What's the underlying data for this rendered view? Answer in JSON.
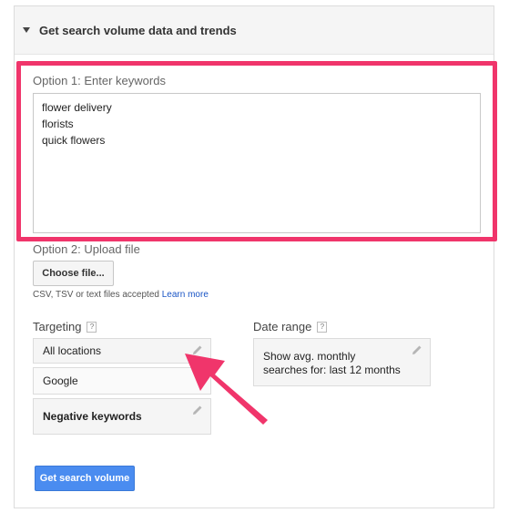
{
  "panel": {
    "title": "Get search volume data and trends"
  },
  "option1": {
    "label": "Option 1: Enter keywords",
    "keywords": [
      "flower delivery",
      "florists",
      "quick flowers"
    ]
  },
  "option2": {
    "label": "Option 2: Upload file",
    "choose_button": "Choose file...",
    "hint": "CSV, TSV or text files accepted",
    "learn_more": "Learn more"
  },
  "targeting": {
    "label": "Targeting",
    "help": "?",
    "location": "All locations",
    "network": "Google",
    "negative": "Negative keywords"
  },
  "date_range": {
    "label": "Date range",
    "help": "?",
    "value": "Show avg. monthly searches for: last 12 months"
  },
  "submit": {
    "label": "Get search volume"
  },
  "colors": {
    "highlight": "#f0356b",
    "primary": "#4a8cf0",
    "link": "#1a55c5"
  }
}
